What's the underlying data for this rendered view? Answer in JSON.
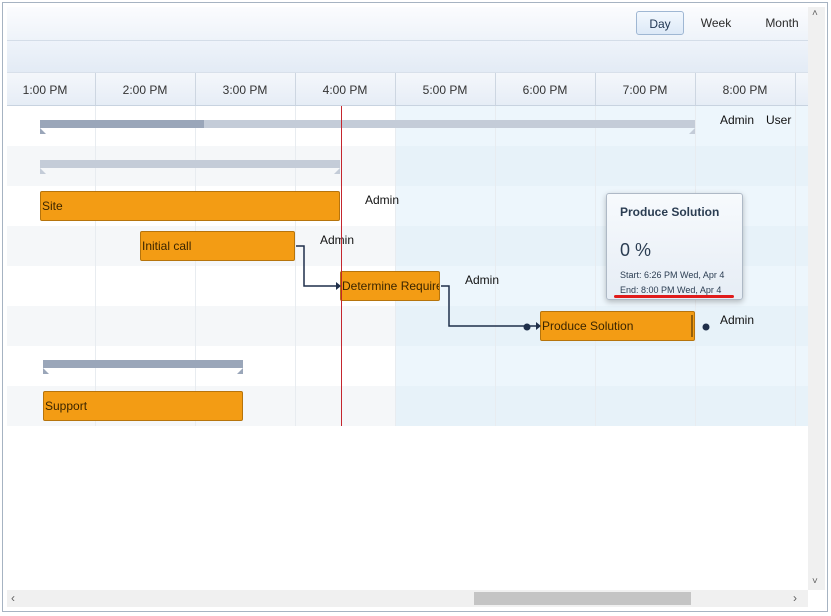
{
  "toolbar": {
    "views": [
      {
        "label": "Day",
        "active": true
      },
      {
        "label": "Week",
        "active": false
      },
      {
        "label": "Month",
        "active": false
      }
    ]
  },
  "timeline": {
    "times": [
      "1:00 PM",
      "2:00 PM",
      "3:00 PM",
      "4:00 PM",
      "5:00 PM",
      "6:00 PM",
      "7:00 PM",
      "8:00 PM"
    ]
  },
  "resources": {
    "header_admin": "Admin",
    "header_user": "User",
    "site": "Admin",
    "initial_call": "Admin",
    "determine": "Admin",
    "produce": "Admin"
  },
  "tasks": {
    "site": "Site",
    "initial_call": "Initial call",
    "determine": "Determine Require",
    "produce": "Produce Solution",
    "support": "Support"
  },
  "tooltip": {
    "title": "Produce Solution",
    "percent": "0 %",
    "start": "Start: 6:26 PM Wed, Apr 4",
    "end": "End: 8:00 PM Wed, Apr 4"
  },
  "colors": {
    "task_bar": "#f39c14",
    "summary_bar": "#c4ccd8",
    "now_line": "#c4262e",
    "highlight": "#e01b1b"
  },
  "scrollbars": {
    "left_arrow": "left-arrow-icon",
    "right_arrow": "right-arrow-icon",
    "up_arrow": "up-arrow-icon",
    "down_arrow": "down-arrow-icon"
  }
}
